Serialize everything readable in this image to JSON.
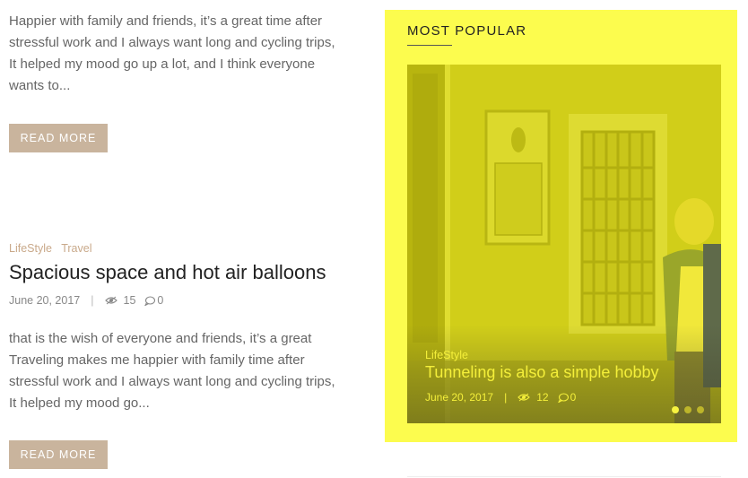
{
  "posts": [
    {
      "excerpt": "Happier with family and friends, it’s a great time after stressful work and I always want long and cycling trips, It helped my mood go up a lot, and I think everyone wants to...",
      "read_more": "READ MORE"
    },
    {
      "categories": [
        "LifeStyle",
        "Travel"
      ],
      "title": "Spacious space and hot air balloons",
      "date": "June 20, 2017",
      "views": "15",
      "comments": "0",
      "excerpt": "that is the wish of everyone and friends, it’s a great Traveling makes me happier with family time after stressful work and I always want long and cycling trips, It helped my mood go...",
      "read_more": "READ MORE"
    }
  ],
  "sidebar": {
    "title": "MOST POPULAR",
    "slide": {
      "category": "LifeStyle",
      "title": "Tunneling is also a simple hobby",
      "date": "June 20, 2017",
      "views": "12",
      "comments": "0"
    },
    "active_slide": 1,
    "slide_count": 3
  },
  "icons": {
    "views": "eye-icon",
    "comments": "comment-icon"
  },
  "colors": {
    "accent": "#c9b49d",
    "sidebar_bg": "#fcfc4e",
    "slide_text": "#f4ef3a"
  }
}
